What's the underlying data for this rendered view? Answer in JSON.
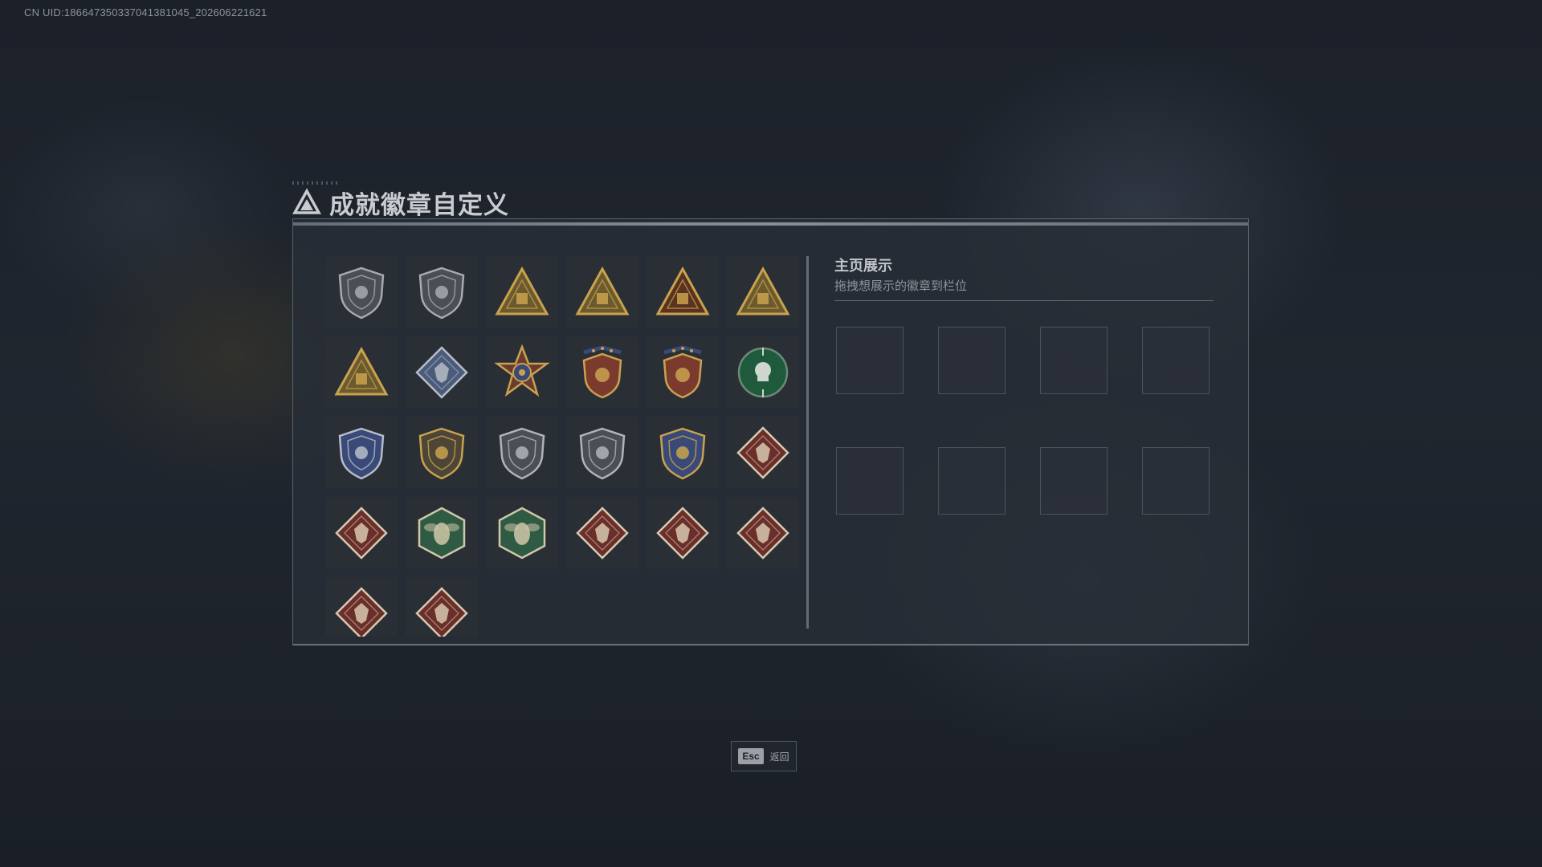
{
  "header": {
    "uid_text": "CN UID:186647350337041381045_202606221621"
  },
  "dialog": {
    "title": "成就徽章自定义",
    "title_icon": "triangle-logo-icon"
  },
  "badge_list": {
    "badges": [
      {
        "name": "badge-shield-triangle-icon",
        "shape": "shield",
        "fill": "#4a4e55",
        "accent": "#a7abb1"
      },
      {
        "name": "badge-helicopter-shield-icon",
        "shape": "shield",
        "fill": "#4a4e55",
        "accent": "#a7abb1"
      },
      {
        "name": "badge-triangle-fortress-icon",
        "shape": "triangle",
        "fill": "#6b5a2e",
        "accent": "#c9a24e"
      },
      {
        "name": "badge-triangle-crate-icon",
        "shape": "triangle",
        "fill": "#6b5a2e",
        "accent": "#c9a24e"
      },
      {
        "name": "badge-triangle-number-one-icon",
        "shape": "triangle",
        "fill": "#5a3220",
        "accent": "#c9a24e"
      },
      {
        "name": "badge-triangle-emblem-icon",
        "shape": "triangle",
        "fill": "#6b5a2e",
        "accent": "#c9a24e"
      },
      {
        "name": "badge-triangle-soldier-icon",
        "shape": "triangle",
        "fill": "#6b5a2e",
        "accent": "#c9a24e"
      },
      {
        "name": "badge-diamond-crate-icon",
        "shape": "diamond",
        "fill": "#4b5b7a",
        "accent": "#b6bdc8"
      },
      {
        "name": "badge-star-medal-icon",
        "shape": "star",
        "fill": "#6a3b31",
        "accent": "#c9a24e"
      },
      {
        "name": "badge-starred-crest-icon",
        "shape": "crest",
        "fill": "#7a3a2e",
        "accent": "#c9a24e"
      },
      {
        "name": "badge-starred-crest-red-icon",
        "shape": "crest",
        "fill": "#7a3a2e",
        "accent": "#c9a24e"
      },
      {
        "name": "badge-green-skull-icon",
        "shape": "circle",
        "fill": "#1f5a3d",
        "accent": "#cfd6cf"
      },
      {
        "name": "badge-blue-crosshair-shield-icon",
        "shape": "shield",
        "fill": "#3a4a78",
        "accent": "#b6bdc8"
      },
      {
        "name": "badge-rifle-shield-icon",
        "shape": "shield",
        "fill": "#4d4537",
        "accent": "#c9a24e"
      },
      {
        "name": "badge-sniper-shield-icon",
        "shape": "shield",
        "fill": "#4a4e55",
        "accent": "#b0b4ba"
      },
      {
        "name": "badge-pistol-shield-icon",
        "shape": "shield",
        "fill": "#4a4e55",
        "accent": "#b0b4ba"
      },
      {
        "name": "badge-gold-crosshair-shield-icon",
        "shape": "shield",
        "fill": "#3a4a78",
        "accent": "#c9a24e"
      },
      {
        "name": "badge-diamond-wolf-icon",
        "shape": "diamond",
        "fill": "#6a2f2a",
        "accent": "#d8c8b0"
      },
      {
        "name": "badge-diamond-wolf-2-icon",
        "shape": "diamond",
        "fill": "#6a2f2a",
        "accent": "#d8c8b0"
      },
      {
        "name": "badge-hex-wasp-icon",
        "shape": "hexagon",
        "fill": "#2f5a44",
        "accent": "#d0c8a8"
      },
      {
        "name": "badge-hex-wasp-2-icon",
        "shape": "hexagon",
        "fill": "#2f5a44",
        "accent": "#d0c8a8"
      },
      {
        "name": "badge-diamond-dragon-icon",
        "shape": "diamond",
        "fill": "#6a2f2a",
        "accent": "#d8c8b0"
      },
      {
        "name": "badge-diamond-dragon-2-icon",
        "shape": "diamond",
        "fill": "#6a2f2a",
        "accent": "#d8c8b0"
      },
      {
        "name": "badge-diamond-runner-icon",
        "shape": "diamond",
        "fill": "#6a2f2a",
        "accent": "#d8c8b0"
      },
      {
        "name": "badge-diamond-fist-icon",
        "shape": "diamond",
        "fill": "#6a2f2a",
        "accent": "#d8c8b0"
      },
      {
        "name": "badge-diamond-rifles-icon",
        "shape": "diamond",
        "fill": "#6a2f2a",
        "accent": "#d8c8b0"
      }
    ]
  },
  "showcase": {
    "title": "主页展示",
    "subtitle": "拖拽想展示的徽章到栏位",
    "slot_count": 8
  },
  "footer": {
    "esc_key": "Esc",
    "esc_label": "返回"
  },
  "colors": {
    "background": "#1d222a",
    "panel": "#282e37",
    "gold_accent": "#c9a24e",
    "text_primary": "#c8ccd1"
  }
}
